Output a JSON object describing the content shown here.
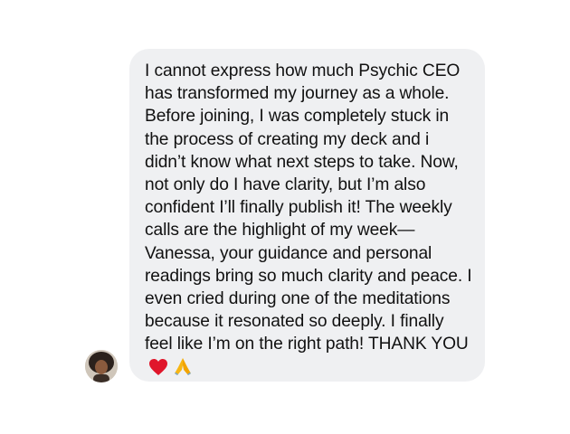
{
  "message": {
    "text": "I cannot express how much Psychic CEO has transformed my journey as a whole. Before joining, I was completely stuck in the process of creating my deck and i didn’t know what next steps to take. Now, not only do I have clarity, but I’m also confident I’ll finally publish it! The weekly calls are the highlight of my week—Vanessa, your guidance and personal readings bring so much clarity and peace. I even cried during one of the meditations because it resonated so deeply. I finally feel like I’m on the right path! THANK YOU",
    "emojis": [
      "heart-icon",
      "folded-hands-icon"
    ]
  },
  "colors": {
    "bubble": "#eff0f2",
    "text": "#111111",
    "heart": "#e0162b",
    "hands": "#f7b614"
  }
}
